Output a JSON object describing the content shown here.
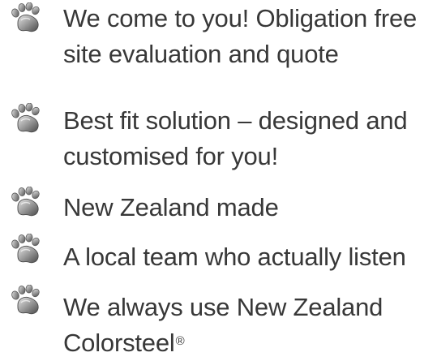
{
  "features": [
    {
      "icon": "paw-print-icon",
      "lines": [
        "We come to you! Obligation free",
        "site evaluation and quote"
      ]
    },
    {
      "icon": "paw-print-icon",
      "lines": [
        "Best fit solution – designed and",
        "customised for you!"
      ]
    },
    {
      "icon": "paw-print-icon",
      "lines": [
        "New Zealand made"
      ]
    },
    {
      "icon": "paw-print-icon",
      "lines": [
        "A local team who actually listen"
      ]
    },
    {
      "icon": "paw-print-icon",
      "lines": [
        "We always use New Zealand",
        "Colorsteel"
      ],
      "trademark": "®"
    }
  ],
  "colors": {
    "text": "#383838",
    "icon_light": "#c9c9c9",
    "icon_dark": "#6e6e6e"
  }
}
